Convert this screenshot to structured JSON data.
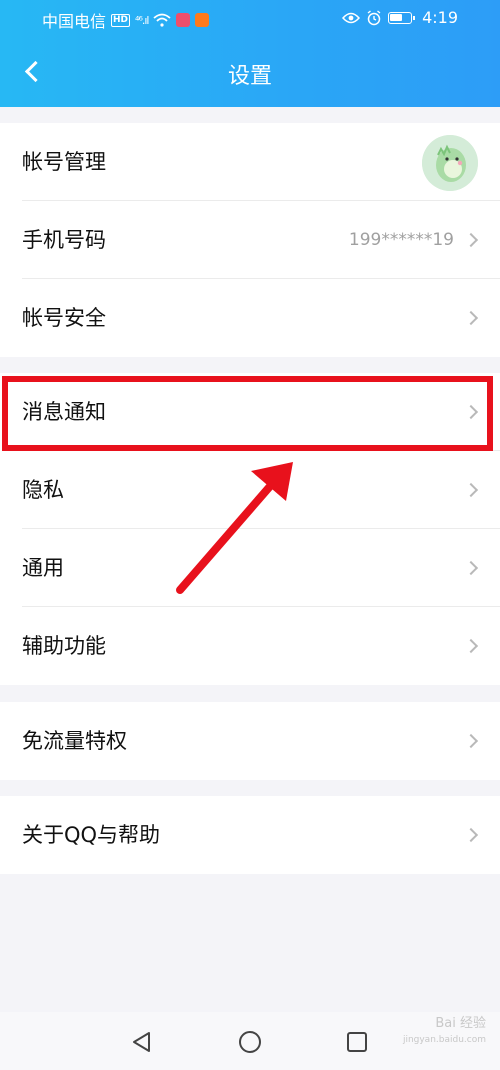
{
  "status_bar": {
    "carrier": "中国电信",
    "network_badge": "HD",
    "signal": "⁴⁶.ıl",
    "time": "4:19",
    "colors": {
      "app1": "#ef4e6b",
      "app2": "#ff7a1a"
    }
  },
  "header": {
    "title": "设置",
    "back_icon": "chevron-left-icon",
    "gradient": [
      "#27b8f4",
      "#2d9df7"
    ]
  },
  "groups": [
    {
      "items": [
        {
          "label": "帐号管理",
          "trailing": "avatar"
        },
        {
          "label": "手机号码",
          "value": "199******19",
          "trailing": "chevron"
        },
        {
          "label": "帐号安全",
          "trailing": "chevron"
        }
      ]
    },
    {
      "items": [
        {
          "label": "消息通知",
          "trailing": "chevron",
          "highlighted": true
        },
        {
          "label": "隐私",
          "trailing": "chevron"
        },
        {
          "label": "通用",
          "trailing": "chevron"
        },
        {
          "label": "辅助功能",
          "trailing": "chevron"
        }
      ]
    },
    {
      "items": [
        {
          "label": "免流量特权",
          "trailing": "chevron"
        }
      ]
    },
    {
      "items": [
        {
          "label": "关于QQ与帮助",
          "trailing": "chevron"
        }
      ]
    }
  ],
  "annotation": {
    "color": "#e8111c",
    "shape": "rectangle-with-arrow"
  },
  "navbar": {
    "icons": [
      "triangle-back-icon",
      "circle-home-icon",
      "square-recent-icon"
    ]
  },
  "watermark": {
    "text": "Bai 经验",
    "subtext": "jingyan.baidu.com"
  }
}
